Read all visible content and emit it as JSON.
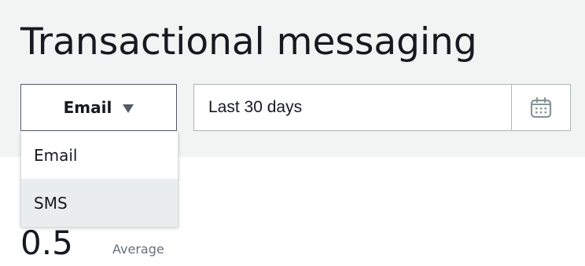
{
  "page": {
    "title": "Transactional messaging"
  },
  "channel_select": {
    "selected": "Email",
    "options": [
      "Email",
      "SMS"
    ],
    "highlighted": "SMS"
  },
  "date_range": {
    "value": "Last 30 days",
    "calendar_icon": "calendar-icon"
  },
  "metric": {
    "value": "0.5",
    "label": "Average"
  },
  "colors": {
    "background": "#f2f3f3",
    "border_dark": "#545b64",
    "border_light": "#aab7b8",
    "highlight": "#eaeded",
    "muted_text": "#687078"
  }
}
